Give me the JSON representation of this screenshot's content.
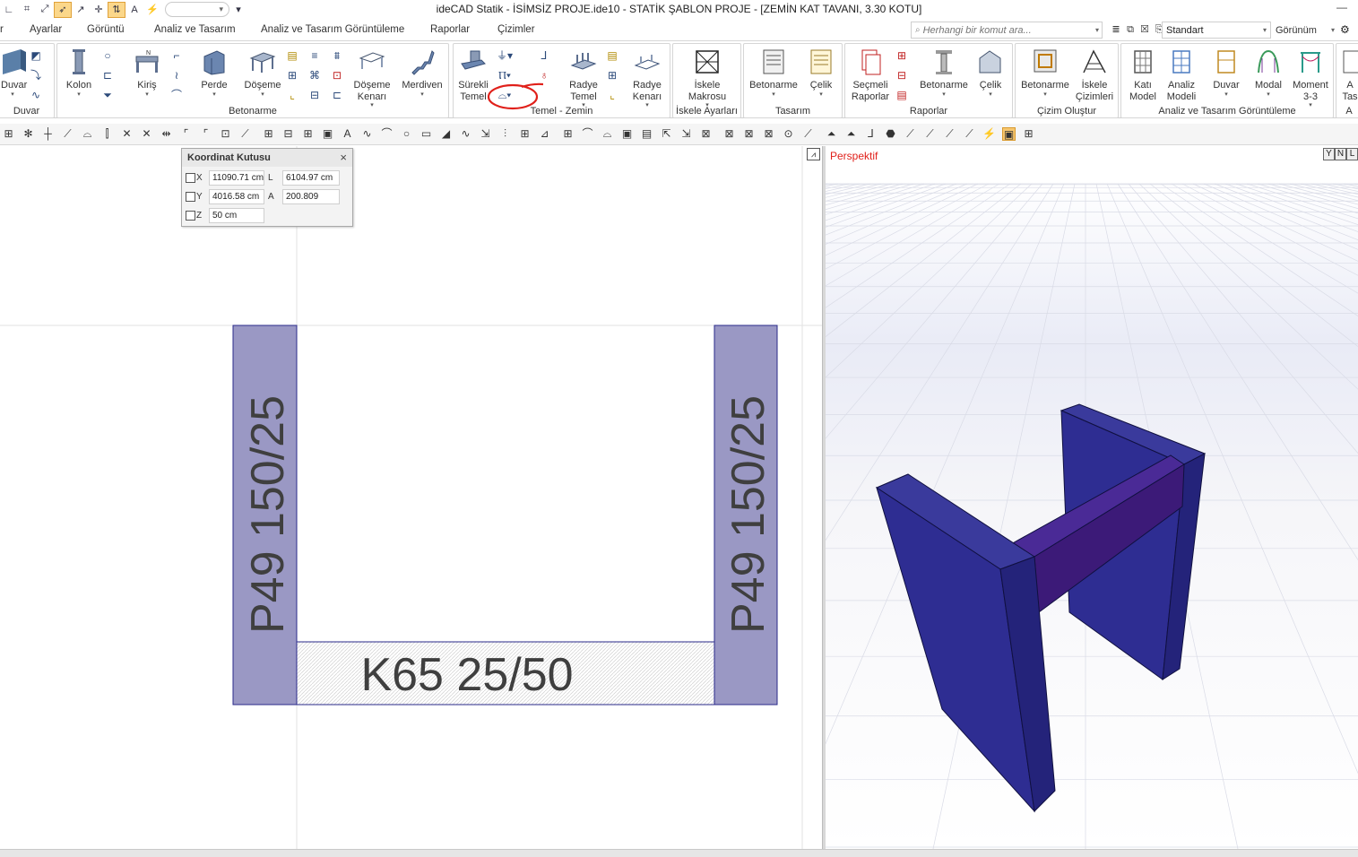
{
  "window": {
    "title": "ideCAD Statik - İSİMSİZ PROJE.ide10 - STATİK ŞABLON PROJE - [ZEMİN KAT TAVANI,  3.30 KOTU]",
    "minimize": "—"
  },
  "quick_access": {
    "dropdown_symbol": "▾",
    "customize_symbol": "▾"
  },
  "tabs": [
    "r",
    "Ayarlar",
    "Görüntü",
    "Analiz ve Tasarım",
    "Analiz ve Tasarım Görüntüleme",
    "Raporlar",
    "Çizimler"
  ],
  "search": {
    "placeholder": "Herhangi bir komut ara..."
  },
  "style_select": {
    "value": "Standart"
  },
  "view_select": {
    "value": "Görünüm"
  },
  "ribbon": {
    "groups": [
      {
        "label": "Duvar",
        "buttons": [
          "Duvar"
        ]
      },
      {
        "label": "Betonarme",
        "buttons": [
          "Kolon",
          "Kiriş",
          "Perde",
          "Döşeme",
          "Döşeme Kenarı",
          "Merdiven"
        ]
      },
      {
        "label": "Temel - Zemin",
        "buttons": [
          "Sürekli Temel",
          "Radye Temel",
          "Radye Kenarı"
        ]
      },
      {
        "label": "İskele Ayarları",
        "buttons": [
          "İskele Makrosu"
        ]
      },
      {
        "label": "Tasarım",
        "buttons": [
          "Betonarme",
          "Çelik"
        ]
      },
      {
        "label": "Raporlar",
        "buttons": [
          "Seçmeli Raporlar",
          "Betonarme",
          "Çelik"
        ]
      },
      {
        "label": "Çizim Oluştur",
        "buttons": [
          "Betonarme",
          "İskele Çizimleri"
        ]
      },
      {
        "label": "Analiz ve Tasarım Görüntüleme",
        "buttons": [
          "Katı Model",
          "Analiz Modeli",
          "Duvar",
          "Modal",
          "Moment 3-3"
        ]
      },
      {
        "label": "A",
        "buttons": [
          "A Tas"
        ]
      }
    ]
  },
  "coord_box": {
    "title": "Koordinat Kutusu",
    "close": "×",
    "x_label": "X",
    "x_value": "11090.71 cm",
    "y_label": "Y",
    "y_value": "4016.58 cm",
    "z_label": "Z",
    "z_value": "50 cm",
    "l_label": "L",
    "l_value": "6104.97 cm",
    "a_label": "A",
    "a_value": "200.809"
  },
  "plan": {
    "left_column_label": "P49 150/25",
    "right_column_label": "P49 150/25",
    "beam_label": "K65 25/50",
    "collapse_symbol": "⩘"
  },
  "perspective": {
    "label": "Perspektif",
    "buttons": [
      "Y",
      "N",
      "L"
    ]
  },
  "colors": {
    "column_fill": "#9a98c4",
    "beam_hatch": "#d9d9d9",
    "wall_3d": "#2e2d92",
    "beam_3d": "#3c1a78",
    "annotation": "#e0201a"
  }
}
